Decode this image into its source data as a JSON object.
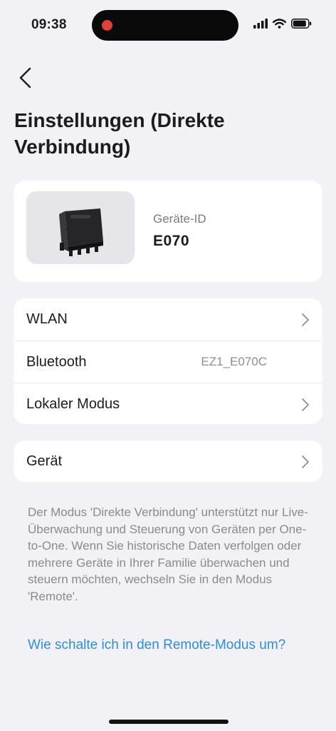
{
  "status_bar": {
    "time": "09:38"
  },
  "header": {
    "title": "Einstellungen (Direkte Verbindung)"
  },
  "device": {
    "id_label": "Geräte-ID",
    "id_value": "E070"
  },
  "settings": {
    "wlan_label": "WLAN",
    "bluetooth_label": "Bluetooth",
    "bluetooth_value": "EZ1_E070C",
    "local_mode_label": "Lokaler Modus"
  },
  "device_row": {
    "label": "Gerät"
  },
  "info": {
    "text": "Der Modus 'Direkte Verbindung' unterstützt nur Live-Überwachung und Steuerung von Geräten per One-to-One. Wenn Sie historische Daten verfolgen oder mehrere Geräte in Ihrer Familie überwachen und steuern möchten, wechseln Sie in den Modus 'Remote'.",
    "link": "Wie schalte ich in den Remote-Modus um?"
  },
  "colors": {
    "link": "#2d8de0",
    "background": "#f2f1f6",
    "recording": "#e0403a"
  }
}
